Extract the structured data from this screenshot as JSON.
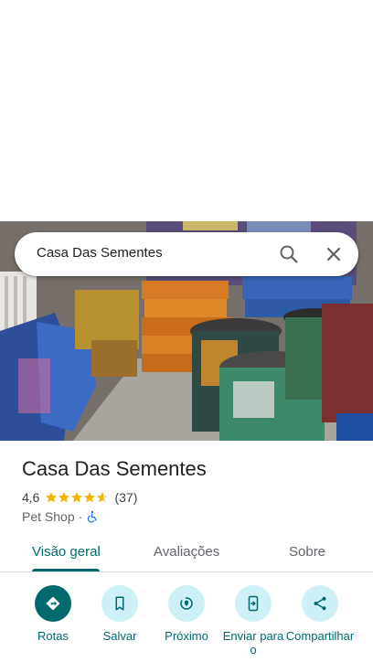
{
  "search": {
    "query": "Casa Das Sementes"
  },
  "place": {
    "name": "Casa Das Sementes",
    "rating": "4,6",
    "stars": 4.6,
    "review_count": "(37)",
    "category": "Pet Shop",
    "separator": "·",
    "accessibility_icon": "wheelchair-icon"
  },
  "tabs": [
    {
      "label": "Visão geral",
      "active": true
    },
    {
      "label": "Avaliações",
      "active": false
    },
    {
      "label": "Sobre",
      "active": false
    }
  ],
  "actions": [
    {
      "label": "Rotas",
      "icon": "directions-icon"
    },
    {
      "label": "Salvar",
      "icon": "bookmark-icon"
    },
    {
      "label": "Próximo",
      "icon": "nearby-icon"
    },
    {
      "label": "Enviar para o",
      "icon": "send-to-phone-icon"
    },
    {
      "label": "Compartilhar",
      "icon": "share-icon"
    }
  ],
  "colors": {
    "accent": "#00696f",
    "action_bg": "#cdf1f7",
    "star": "#f4b400"
  }
}
